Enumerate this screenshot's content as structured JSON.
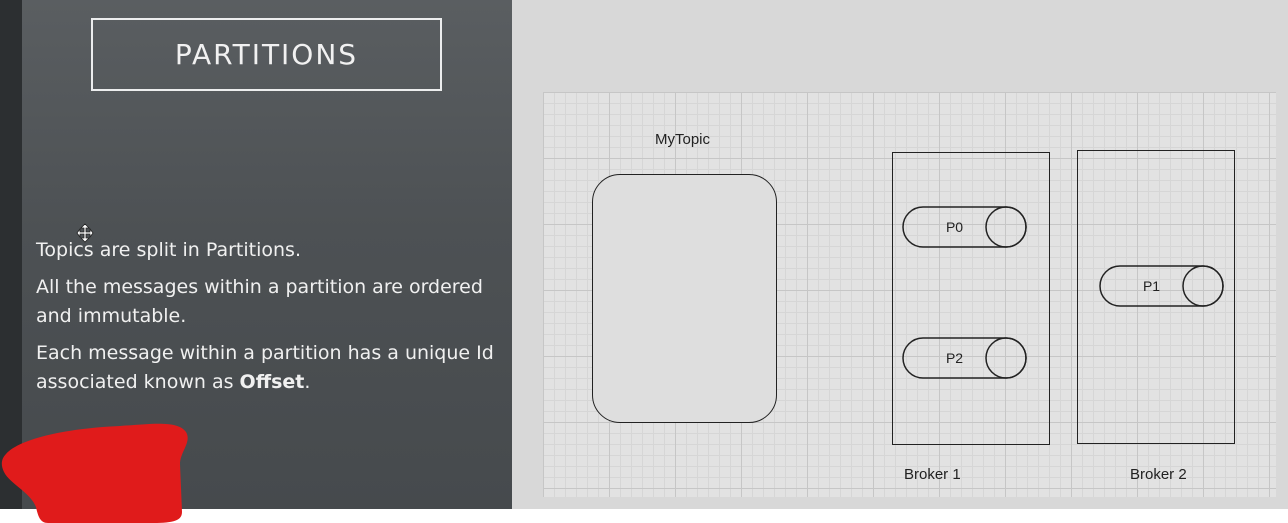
{
  "slide": {
    "title": "PARTITIONS",
    "bullets": [
      {
        "text": "Topics are split in Partitions."
      },
      {
        "text": "All the messages within a partition are ordered and immutable."
      },
      {
        "text_before": "Each message within a partition has a unique Id associated known as ",
        "bold": "Offset",
        "text_after": "."
      }
    ]
  },
  "diagram": {
    "topic_label": "MyTopic",
    "brokers": [
      {
        "label": "Broker 1",
        "partitions": [
          "P0",
          "P2"
        ]
      },
      {
        "label": "Broker 2",
        "partitions": [
          "P1"
        ]
      }
    ]
  },
  "colors": {
    "slide_background": "#4d5154",
    "canvas_background": "#d8d8d8",
    "grid": "#c6c6c6",
    "redaction": "#e01b1b"
  },
  "icons": [
    "move-cursor-icon"
  ]
}
